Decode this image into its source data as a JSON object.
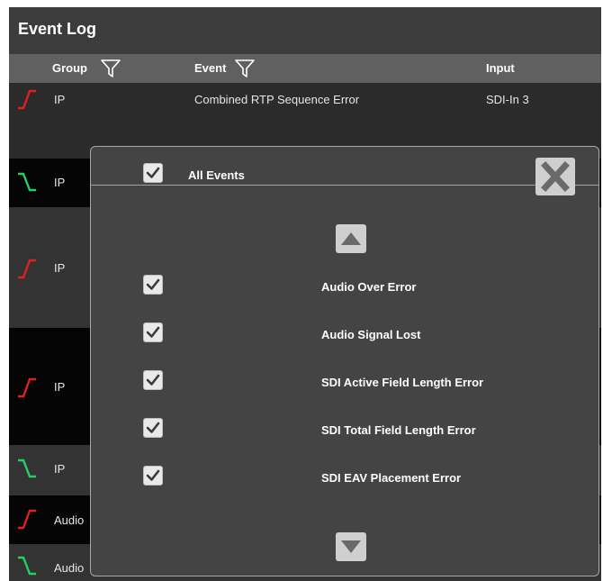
{
  "window": {
    "title": "Event Log"
  },
  "columns": {
    "group": "Group",
    "event": "Event",
    "input": "Input"
  },
  "rows": [
    {
      "group": "IP",
      "event": "Combined RTP Sequence Error",
      "input": "SDI-In 3",
      "state": "error"
    },
    {
      "group": "IP",
      "event": "",
      "input": "",
      "state": "clear"
    },
    {
      "group": "IP",
      "event": "",
      "input": "",
      "state": "error"
    },
    {
      "group": "IP",
      "event": "",
      "input": "",
      "state": "error"
    },
    {
      "group": "IP",
      "event": "",
      "input": "",
      "state": "clear"
    },
    {
      "group": "Audio",
      "event": "",
      "input": "",
      "state": "error"
    },
    {
      "group": "Audio",
      "event": "",
      "input": "",
      "state": "clear"
    }
  ],
  "filter_dialog": {
    "all_events_label": "All Events",
    "all_events_checked": true,
    "close_icon": "close-x-icon",
    "items": [
      {
        "label": "Audio Over Error",
        "checked": true
      },
      {
        "label": "Audio Signal Lost",
        "checked": true
      },
      {
        "label": "SDI Active Field Length Error",
        "checked": true
      },
      {
        "label": "SDI Total Field Length Error",
        "checked": true
      },
      {
        "label": "SDI EAV Placement Error",
        "checked": true
      }
    ]
  },
  "colors": {
    "error": "#e02020",
    "clear": "#22d060",
    "header_bg": "#606060",
    "dialog_bg": "#444444"
  }
}
